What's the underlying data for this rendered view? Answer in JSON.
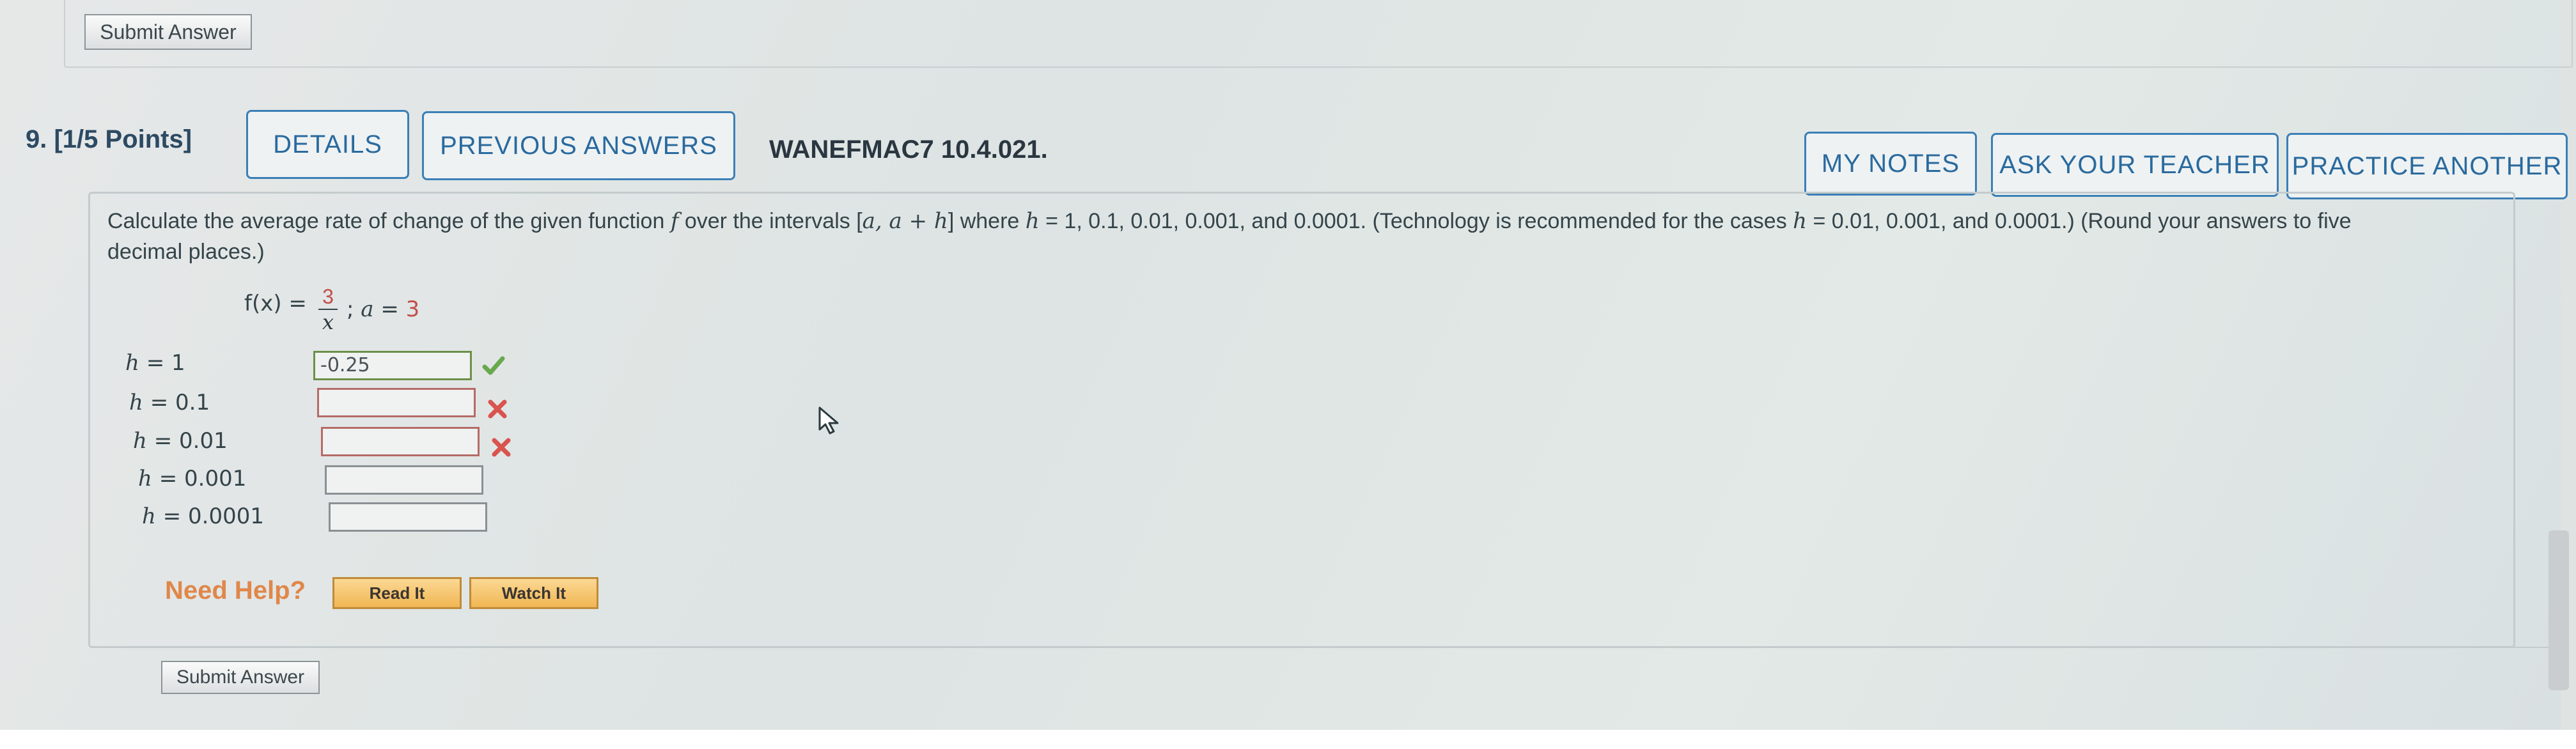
{
  "previous_question": {
    "submit_label": "Submit Answer"
  },
  "question": {
    "number": "9.",
    "points": "[1/5 Points]",
    "details_label": "DETAILS",
    "previous_answers_label": "PREVIOUS ANSWERS",
    "code": "WANEFMAC7 10.4.021.",
    "my_notes_label": "MY NOTES",
    "ask_teacher_label": "ASK YOUR TEACHER",
    "practice_another_label": "PRACTICE ANOTHER",
    "text_part1": "Calculate the average rate of change of the given function ",
    "text_f": "f",
    "text_part2": " over the intervals [",
    "text_interval": "a, a + h",
    "text_part3": "] where ",
    "text_h1": "h",
    "text_part4": " = 1, 0.1, 0.01, 0.001, and 0.0001. (Technology is recommended for the cases ",
    "text_h2": "h",
    "text_part5": " = 0.01, 0.001, and 0.0001.) (Round your answers to five",
    "text_line2": "decimal places.)",
    "function_lhs": "f(x) = ",
    "frac_num": "3",
    "frac_den": "x",
    "function_cond_sep": ";  ",
    "function_cond_a": "a",
    "function_cond_eq": " = ",
    "function_cond_val": "3",
    "rows": [
      {
        "h": "h",
        "eq": " = 1",
        "value": "-0.25",
        "status": "correct"
      },
      {
        "h": "h",
        "eq": " = 0.1",
        "value": "",
        "status": "incorrect"
      },
      {
        "h": "h",
        "eq": " = 0.01",
        "value": "",
        "status": "incorrect"
      },
      {
        "h": "h",
        "eq": " = 0.001",
        "value": "",
        "status": "none"
      },
      {
        "h": "h",
        "eq": " = 0.0001",
        "value": "",
        "status": "none"
      }
    ],
    "need_help_label": "Need Help?",
    "read_it_label": "Read It",
    "watch_it_label": "Watch It",
    "submit_label": "Submit Answer"
  },
  "colors": {
    "accent": "#3a7fb6",
    "correct": "#6aa84f",
    "incorrect": "#d9534f",
    "help": "#e0874a"
  }
}
